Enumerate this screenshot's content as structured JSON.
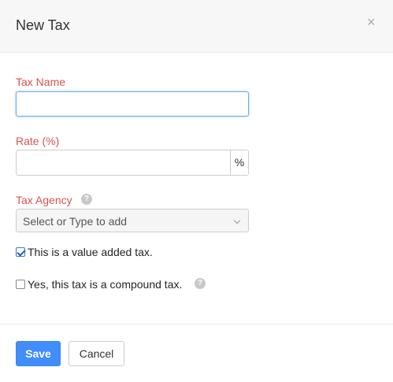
{
  "dialog": {
    "title": "New Tax",
    "close_glyph": "×"
  },
  "form": {
    "tax_name": {
      "label": "Tax Name",
      "value": "",
      "placeholder": ""
    },
    "rate": {
      "label": "Rate (%)",
      "value": "",
      "addon": "%"
    },
    "tax_agency": {
      "label": "Tax Agency",
      "help_glyph": "?",
      "selected": "Select or Type to add"
    },
    "value_added": {
      "label": "This is a value added tax.",
      "checked": true
    },
    "compound": {
      "label": "Yes, this tax is a compound tax.",
      "checked": false,
      "help_glyph": "?"
    }
  },
  "footer": {
    "save_label": "Save",
    "cancel_label": "Cancel"
  },
  "colors": {
    "label_red": "#d9534f",
    "primary_blue": "#408dfb",
    "focus_blue": "#66afe9"
  }
}
